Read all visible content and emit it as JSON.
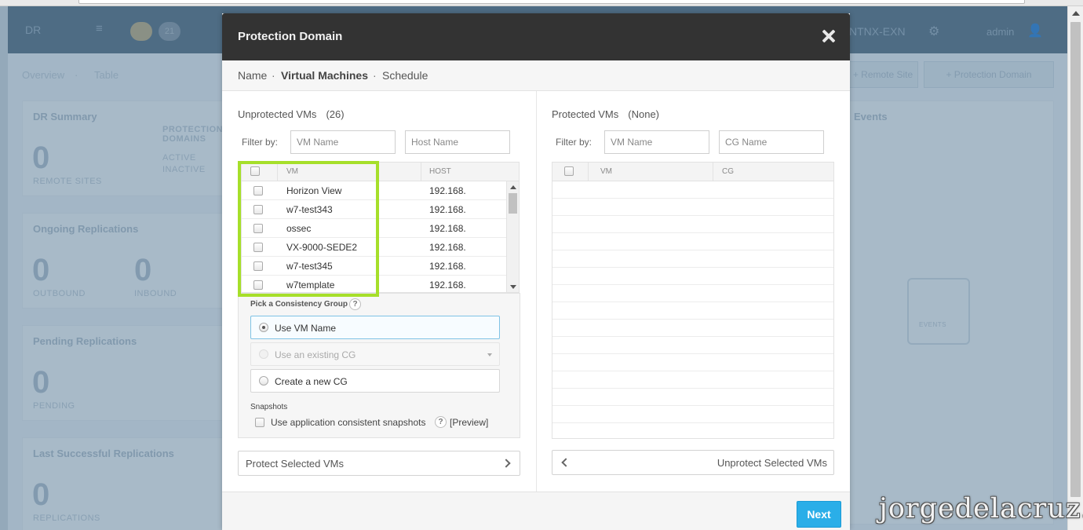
{
  "background": {
    "app_name": "DR",
    "pills": [
      "",
      "21"
    ],
    "cluster": "NTNX-EXN",
    "user": "admin",
    "breadcrumb": [
      "Overview",
      "·",
      "Table"
    ],
    "buttons": [
      "+ Remote Site",
      "+ Protection Domain"
    ],
    "dr_summary": {
      "title": "DR Summary",
      "remote_sites_value": "0",
      "remote_sites_label": "REMOTE SITES",
      "pd_title": "PROTECTION DOMAINS",
      "active": "ACTIVE",
      "inactive": "INACTIVE"
    },
    "ongoing": {
      "title": "Ongoing Replications",
      "outbound_value": "0",
      "outbound_label": "OUTBOUND",
      "inbound_value": "0",
      "inbound_label": "INBOUND"
    },
    "pending": {
      "title": "Pending Replications",
      "value": "0",
      "label": "PENDING"
    },
    "last_success": {
      "title": "Last Successful Replications",
      "value": "0",
      "label": "REPLICATIONS"
    },
    "events": {
      "title": "Events",
      "empty_label": "EVENTS"
    }
  },
  "modal": {
    "title": "Protection Domain",
    "steps": [
      "Name",
      "Virtual Machines",
      "Schedule"
    ],
    "step_separator": "·",
    "active_step": "Virtual Machines"
  },
  "unprotected": {
    "title": "Unprotected VMs",
    "count": "(26)",
    "filter_label": "Filter by:",
    "vm_name_placeholder": "VM Name",
    "host_name_placeholder": "Host Name",
    "columns": [
      "VM",
      "HOST"
    ],
    "rows": [
      {
        "vm": "Horizon View",
        "host": "192.168."
      },
      {
        "vm": "w7-test343",
        "host": "192.168."
      },
      {
        "vm": "ossec",
        "host": "192.168."
      },
      {
        "vm": "VX-9000-SEDE2",
        "host": "192.168."
      },
      {
        "vm": "w7-test345",
        "host": "192.168."
      },
      {
        "vm": "w7template",
        "host": "192.168."
      }
    ]
  },
  "consistency": {
    "title": "Pick a Consistency Group",
    "help": "?",
    "options": [
      "Use VM Name",
      "Use an existing CG",
      "Create a new CG"
    ],
    "selected": "Use VM Name",
    "snapshots_title": "Snapshots",
    "snapshot_option": "Use application consistent snapshots",
    "preview": "[Preview]"
  },
  "protected": {
    "title": "Protected VMs",
    "count": "(None)",
    "filter_label": "Filter by:",
    "vm_name_placeholder": "VM Name",
    "cg_name_placeholder": "CG Name",
    "columns": [
      "VM",
      "CG"
    ]
  },
  "actions": {
    "protect": "Protect Selected VMs",
    "unprotect": "Unprotect Selected VMs",
    "next": "Next"
  },
  "watermark": "jorgedelacruz.es",
  "colors": {
    "highlight": "#a6df2a",
    "primary": "#2aaee8",
    "header": "#333333"
  }
}
